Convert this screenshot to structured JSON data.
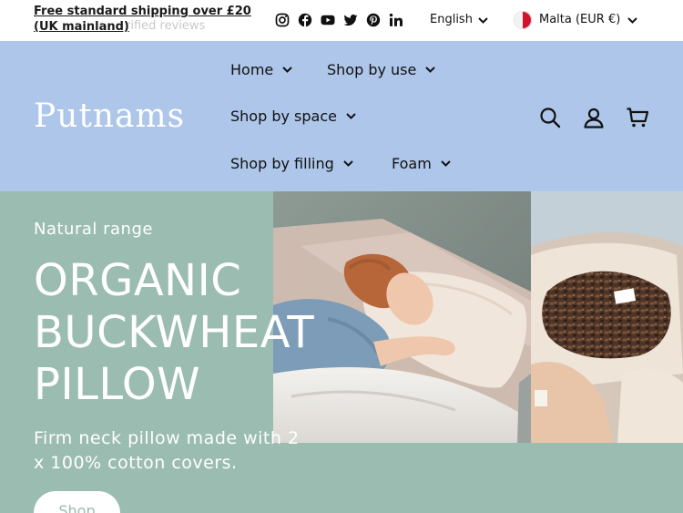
{
  "topbar": {
    "promo_text": "Free standard shipping over £20 (UK mainland)",
    "promo_ghost": "rified reviews",
    "socials": [
      {
        "icon": "instagram-icon"
      },
      {
        "icon": "facebook-icon"
      },
      {
        "icon": "youtube-icon"
      },
      {
        "icon": "twitter-icon"
      },
      {
        "icon": "pinterest-icon"
      },
      {
        "icon": "linkedin-icon"
      }
    ],
    "language": "English",
    "currency": "Malta (EUR €)"
  },
  "header": {
    "logo": "Putnams",
    "nav": [
      {
        "label": "Home"
      },
      {
        "label": "Shop by use"
      },
      {
        "label": "Shop by space"
      },
      {
        "label": "Shop by filling"
      },
      {
        "label": "Foam"
      }
    ],
    "icons": [
      "search-icon",
      "account-icon",
      "cart-icon"
    ]
  },
  "hero": {
    "eyebrow": "Natural range",
    "headline_lines": [
      "ORGANIC",
      "BUCKWHEAT",
      "PILLOW"
    ],
    "subheading": "Firm neck pillow made with 2 x 100% cotton covers.",
    "button_label": "Shop"
  },
  "colors": {
    "header_bg": "#adc6e9",
    "hero_bg": "#9bbcb0",
    "topbar_bg": "#ffffff",
    "logo_text": "#ffffff"
  }
}
